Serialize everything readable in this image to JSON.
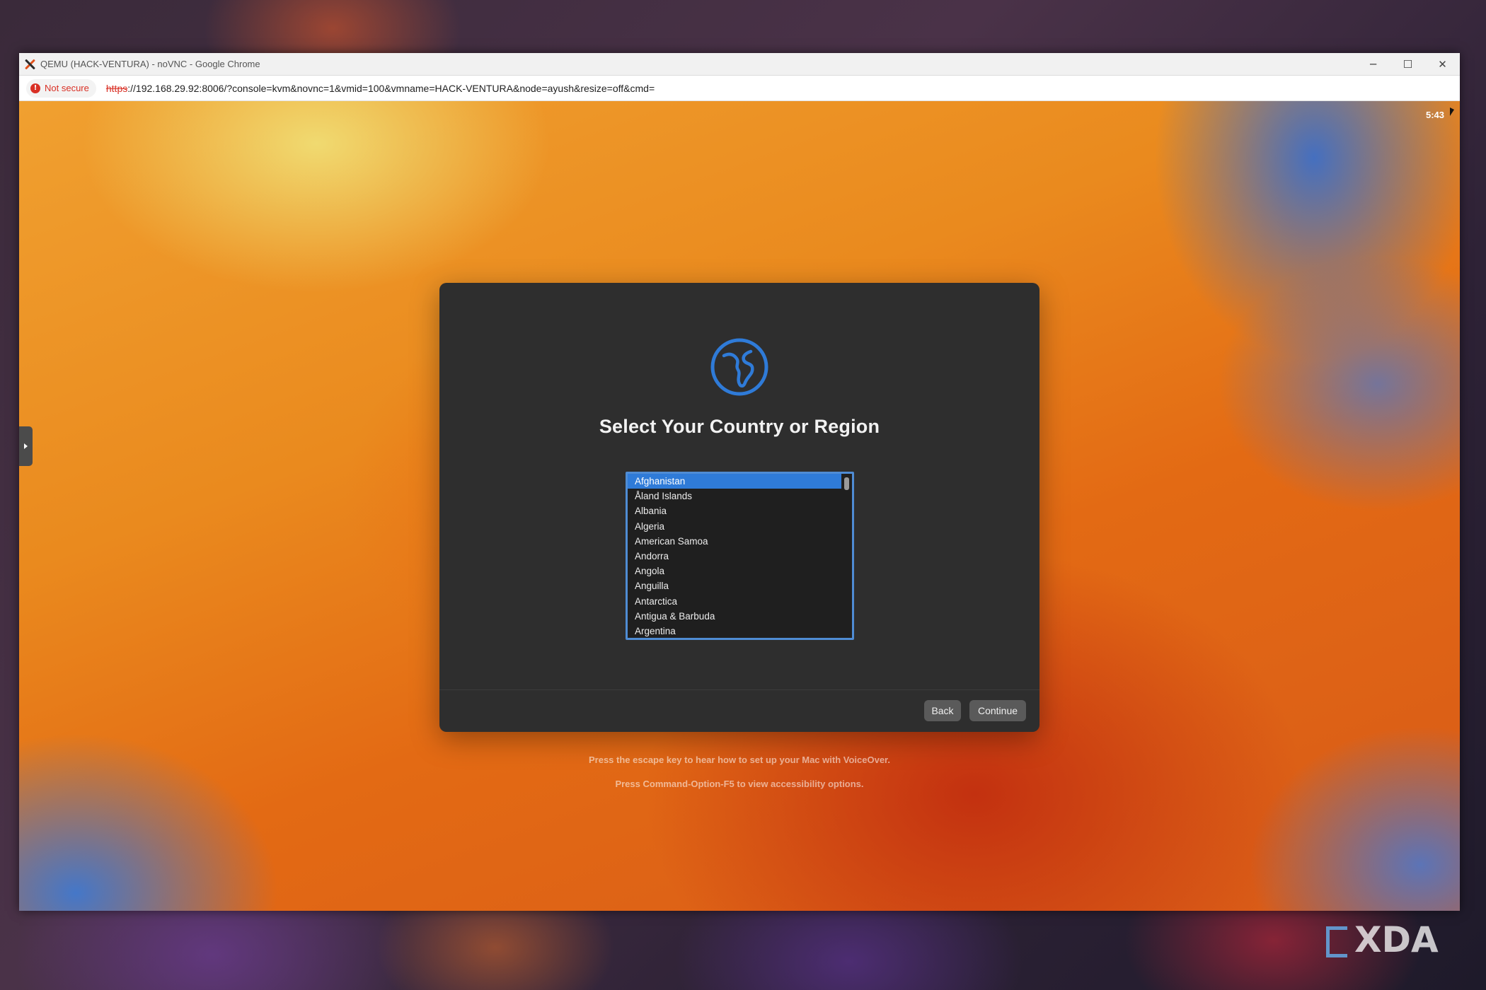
{
  "browser": {
    "window_title": "QEMU (HACK-VENTURA) - noVNC - Google Chrome",
    "controls": {
      "minimize": "─",
      "maximize": "☐",
      "close": "✕"
    },
    "security_label": "Not secure",
    "url_scheme": "https",
    "url_rest": "://192.168.29.92:8006/?console=kvm&novnc=1&vmid=100&vmname=HACK-VENTURA&node=ayush&resize=off&cmd="
  },
  "vm": {
    "clock": "5:43"
  },
  "setup": {
    "title": "Select Your Country or Region",
    "countries": [
      "Afghanistan",
      "Åland Islands",
      "Albania",
      "Algeria",
      "American Samoa",
      "Andorra",
      "Angola",
      "Anguilla",
      "Antarctica",
      "Antigua & Barbuda",
      "Argentina"
    ],
    "selected_country": "Afghanistan",
    "back_label": "Back",
    "continue_label": "Continue",
    "hint_voiceover": "Press the escape key to hear how to set up your Mac with VoiceOver.",
    "hint_accessibility": "Press Command-Option-F5 to view accessibility options."
  },
  "watermark": {
    "text": "XDA"
  },
  "colors": {
    "accent": "#2f7bd8",
    "list_border": "#4f8cd4",
    "dialog_bg": "#2e2e2e",
    "warning": "#d93025"
  }
}
